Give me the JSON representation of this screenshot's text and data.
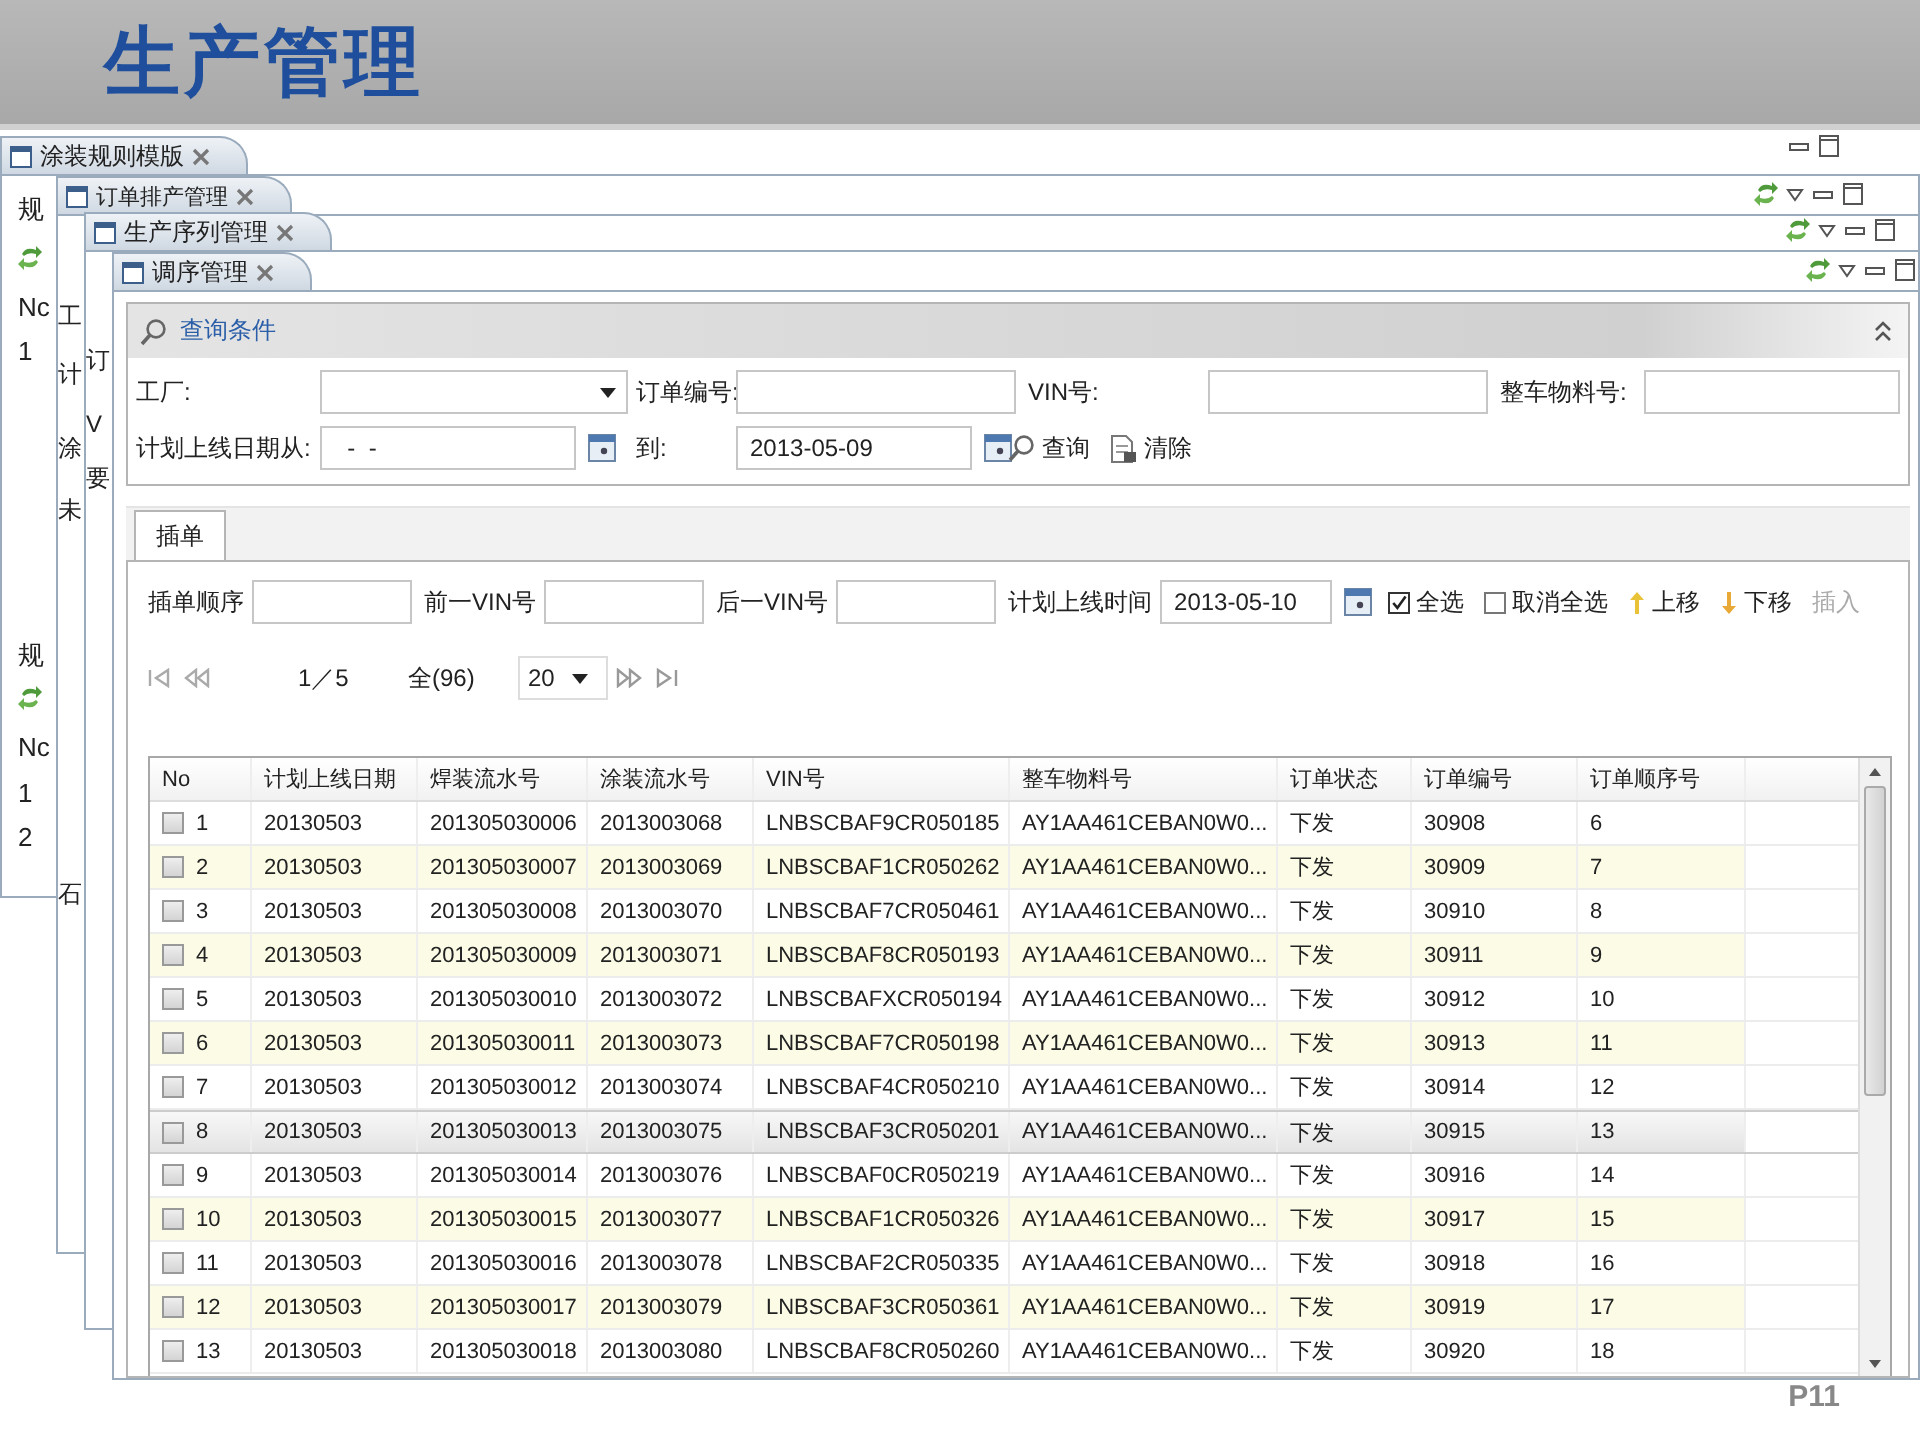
{
  "slide": {
    "title": "生产管理",
    "page": "P11"
  },
  "back_windows": [
    {
      "title": "涂装规则模版",
      "fragments": [
        {
          "kind": "text",
          "text": "规"
        },
        {
          "kind": "refresh"
        },
        {
          "kind": "text",
          "text": "Nc"
        },
        {
          "kind": "text",
          "text": "1"
        },
        {
          "kind": "text",
          "text": "规"
        },
        {
          "kind": "refresh"
        },
        {
          "kind": "text",
          "text": "Nc"
        },
        {
          "kind": "text",
          "text": "1"
        },
        {
          "kind": "text",
          "text": "2"
        }
      ]
    },
    {
      "title": "订单排产管理",
      "fragments": [
        {
          "kind": "text",
          "text": "工"
        },
        {
          "kind": "text",
          "text": "计"
        },
        {
          "kind": "text",
          "text": "涂"
        },
        {
          "kind": "text",
          "text": "未"
        },
        {
          "kind": "text",
          "text": "石"
        }
      ]
    },
    {
      "title": "生产序列管理",
      "fragments": [
        {
          "kind": "text",
          "text": "订"
        },
        {
          "kind": "text",
          "text": "V"
        },
        {
          "kind": "text",
          "text": "要"
        }
      ]
    }
  ],
  "window": {
    "title": "调序管理"
  },
  "query": {
    "title": "查询条件",
    "fields": [
      {
        "label": "工厂:",
        "kind": "dropdown"
      },
      {
        "label": "订单编号:",
        "kind": "text"
      },
      {
        "label": "VIN号:",
        "kind": "text"
      },
      {
        "label": "整车物料号:",
        "kind": "text"
      },
      {
        "label": "计划上线日期从:",
        "kind": "date",
        "value": "  -  -"
      },
      {
        "label": "到:",
        "kind": "date",
        "value": "2013-05-09"
      }
    ],
    "buttons": [
      {
        "label": "查询",
        "kind": "search"
      },
      {
        "label": "清除",
        "kind": "clear"
      }
    ]
  },
  "tabs": [
    {
      "label": "插单",
      "selected": true
    }
  ],
  "insert_toolbar": [
    {
      "kind": "field",
      "label": "插单顺序"
    },
    {
      "kind": "field",
      "label": "前一VIN号"
    },
    {
      "kind": "field",
      "label": "后一VIN号"
    },
    {
      "kind": "date",
      "label": "计划上线时间",
      "value": "2013-05-10"
    },
    {
      "kind": "checkbox",
      "label": "全选",
      "checked": true
    },
    {
      "kind": "checkbox",
      "label": "取消全选",
      "checked": false
    },
    {
      "kind": "move_up",
      "label": "上移",
      "disabled": false
    },
    {
      "kind": "move_down",
      "label": "下移",
      "disabled": false
    },
    {
      "kind": "command",
      "label": "插入",
      "disabled": true
    }
  ],
  "pager": {
    "page": "1／5",
    "total": "全(96)",
    "page_size": "20"
  },
  "table": {
    "columns": [
      "No",
      "计划上线日期",
      "焊装流水号",
      "涂装流水号",
      "VIN号",
      "整车物料号",
      "订单状态",
      "订单编号",
      "订单顺序号"
    ],
    "rows": [
      {
        "checked": false,
        "selected": false,
        "cells": [
          "1",
          "20130503",
          "201305030006",
          "2013003068",
          "LNBSCBAF9CR050185",
          "AY1AA461CEBAN0W0...",
          "下发",
          "30908",
          "6"
        ]
      },
      {
        "checked": false,
        "selected": false,
        "cells": [
          "2",
          "20130503",
          "201305030007",
          "2013003069",
          "LNBSCBAF1CR050262",
          "AY1AA461CEBAN0W0...",
          "下发",
          "30909",
          "7"
        ]
      },
      {
        "checked": false,
        "selected": false,
        "cells": [
          "3",
          "20130503",
          "201305030008",
          "2013003070",
          "LNBSCBAF7CR050461",
          "AY1AA461CEBAN0W0...",
          "下发",
          "30910",
          "8"
        ]
      },
      {
        "checked": false,
        "selected": false,
        "cells": [
          "4",
          "20130503",
          "201305030009",
          "2013003071",
          "LNBSCBAF8CR050193",
          "AY1AA461CEBAN0W0...",
          "下发",
          "30911",
          "9"
        ]
      },
      {
        "checked": false,
        "selected": false,
        "cells": [
          "5",
          "20130503",
          "201305030010",
          "2013003072",
          "LNBSCBAFXCR050194",
          "AY1AA461CEBAN0W0...",
          "下发",
          "30912",
          "10"
        ]
      },
      {
        "checked": false,
        "selected": false,
        "cells": [
          "6",
          "20130503",
          "201305030011",
          "2013003073",
          "LNBSCBAF7CR050198",
          "AY1AA461CEBAN0W0...",
          "下发",
          "30913",
          "11"
        ]
      },
      {
        "checked": false,
        "selected": false,
        "cells": [
          "7",
          "20130503",
          "201305030012",
          "2013003074",
          "LNBSCBAF4CR050210",
          "AY1AA461CEBAN0W0...",
          "下发",
          "30914",
          "12"
        ]
      },
      {
        "checked": false,
        "selected": true,
        "cells": [
          "8",
          "20130503",
          "201305030013",
          "2013003075",
          "LNBSCBAF3CR050201",
          "AY1AA461CEBAN0W0...",
          "下发",
          "30915",
          "13"
        ]
      },
      {
        "checked": false,
        "selected": false,
        "cells": [
          "9",
          "20130503",
          "201305030014",
          "2013003076",
          "LNBSCBAF0CR050219",
          "AY1AA461CEBAN0W0...",
          "下发",
          "30916",
          "14"
        ]
      },
      {
        "checked": false,
        "selected": false,
        "cells": [
          "10",
          "20130503",
          "201305030015",
          "2013003077",
          "LNBSCBAF1CR050326",
          "AY1AA461CEBAN0W0...",
          "下发",
          "30917",
          "15"
        ]
      },
      {
        "checked": false,
        "selected": false,
        "cells": [
          "11",
          "20130503",
          "201305030016",
          "2013003078",
          "LNBSCBAF2CR050335",
          "AY1AA461CEBAN0W0...",
          "下发",
          "30918",
          "16"
        ]
      },
      {
        "checked": false,
        "selected": false,
        "cells": [
          "12",
          "20130503",
          "201305030017",
          "2013003079",
          "LNBSCBAF3CR050361",
          "AY1AA461CEBAN0W0...",
          "下发",
          "30919",
          "17"
        ]
      },
      {
        "checked": false,
        "selected": false,
        "cells": [
          "13",
          "20130503",
          "201305030018",
          "2013003080",
          "LNBSCBAF8CR050260",
          "AY1AA461CEBAN0W0...",
          "下发",
          "30920",
          "18"
        ]
      }
    ]
  }
}
